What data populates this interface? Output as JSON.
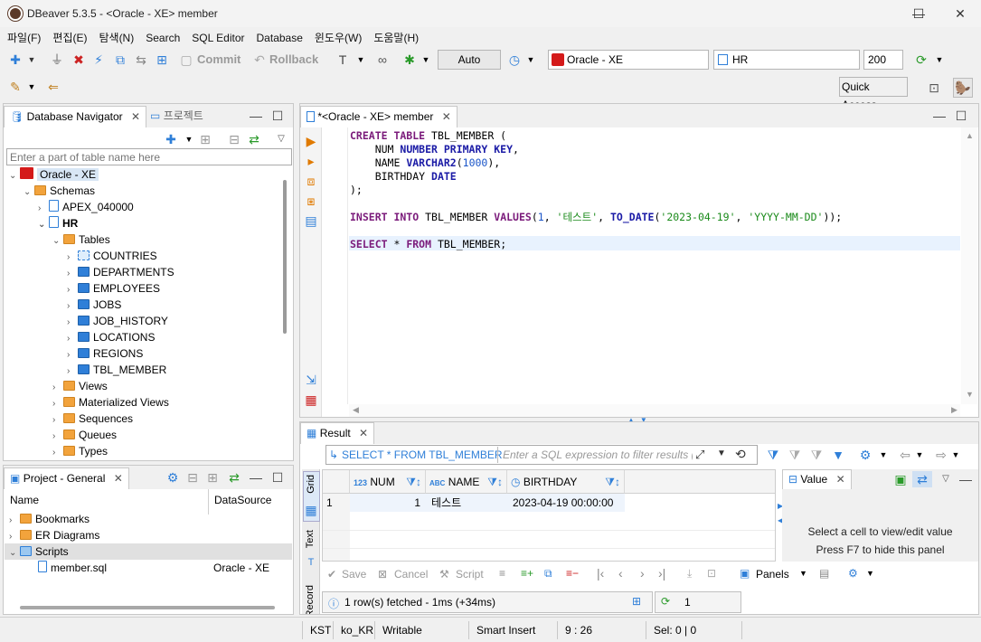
{
  "window": {
    "title": "DBeaver 5.3.5 - <Oracle - XE> member",
    "minimize": "—",
    "maximize": "☐",
    "close": "✕"
  },
  "menu": [
    "파일(F)",
    "편집(E)",
    "탐색(N)",
    "Search",
    "SQL Editor",
    "Database",
    "윈도우(W)",
    "도움말(H)"
  ],
  "toolbar": {
    "commit": "Commit",
    "rollback": "Rollback",
    "mode": "Auto",
    "connection": "Oracle - XE",
    "schema": "HR",
    "limit": "200",
    "quick_access": "Quick Access"
  },
  "navigator": {
    "tab_label": "Database Navigator",
    "tab2_label": "프로젝트",
    "filter_placeholder": "Enter a part of table name here",
    "tree": {
      "connection": "Oracle - XE",
      "schemas": "Schemas",
      "schema1": "APEX_040000",
      "schema2": "HR",
      "tables": "Tables",
      "table_items": [
        "COUNTRIES",
        "DEPARTMENTS",
        "EMPLOYEES",
        "JOBS",
        "JOB_HISTORY",
        "LOCATIONS",
        "REGIONS",
        "TBL_MEMBER"
      ],
      "folders": [
        "Views",
        "Materialized Views",
        "Sequences",
        "Queues",
        "Types"
      ]
    }
  },
  "project": {
    "tab_label": "Project - General",
    "col_name": "Name",
    "col_datasource": "DataSource",
    "items": [
      "Bookmarks",
      "ER Diagrams",
      "Scripts"
    ],
    "script_file": "member.sql",
    "script_ds": "Oracle - XE"
  },
  "editor": {
    "tab_label": "*<Oracle - XE> member",
    "lines": {
      "l1a": "CREATE TABLE",
      "l1b": " TBL_MEMBER (",
      "l2a": "    NUM ",
      "l2b": "NUMBER PRIMARY KEY",
      "l2c": ",",
      "l3a": "    NAME ",
      "l3b": "VARCHAR2",
      "l3c": "(",
      "l3d": "1000",
      "l3e": "),",
      "l4a": "    BIRTHDAY ",
      "l4b": "DATE",
      "l5": ");",
      "l7a": "INSERT INTO",
      "l7b": " TBL_MEMBER ",
      "l7c": "VALUES",
      "l7d": "(",
      "l7e": "1",
      "l7f": ", ",
      "l7g": "'테스트'",
      "l7h": ", ",
      "l7i": "TO_DATE",
      "l7j": "(",
      "l7k": "'2023-04-19'",
      "l7l": ", ",
      "l7m": "'YYYY-MM-DD'",
      "l7n": "));",
      "l9a": "SELECT",
      "l9b": " * ",
      "l9c": "FROM",
      "l9d": " TBL_MEMBER;"
    }
  },
  "result": {
    "tab_label": "Result",
    "filter_query": "SELECT * FROM TBL_MEMBER",
    "filter_placeholder": "Enter a SQL expression to filter results (use Ctrl+Space)",
    "side_grid": "Grid",
    "side_text": "Text",
    "side_record": "Record",
    "columns": [
      {
        "type": "123",
        "name": "NUM"
      },
      {
        "type": "ABC",
        "name": "NAME"
      },
      {
        "type": "",
        "name": "BIRTHDAY"
      }
    ],
    "rows": [
      {
        "row": "1",
        "num": "1",
        "name": "테스트",
        "birthday": "2023-04-19 00:00:00"
      }
    ],
    "value_tab": "Value",
    "value_hint1": "Select a cell to view/edit value",
    "value_hint2": "Press F7 to hide this panel",
    "bottom": {
      "save": "Save",
      "cancel": "Cancel",
      "script": "Script",
      "panels": "Panels"
    },
    "status_text": "1 row(s) fetched - 1ms (+34ms)",
    "refresh_count": "1"
  },
  "statusbar": {
    "tz": "KST",
    "locale": "ko_KR",
    "mode": "Writable",
    "insert": "Smart Insert",
    "pos": "9 : 26",
    "sel": "Sel: 0 | 0"
  },
  "colors": {
    "accent": "#2f7fd8",
    "keyword": "#7b1b7b",
    "string": "#1a8a1a",
    "number": "#1a55c8",
    "selection": "#e8f2fe"
  }
}
